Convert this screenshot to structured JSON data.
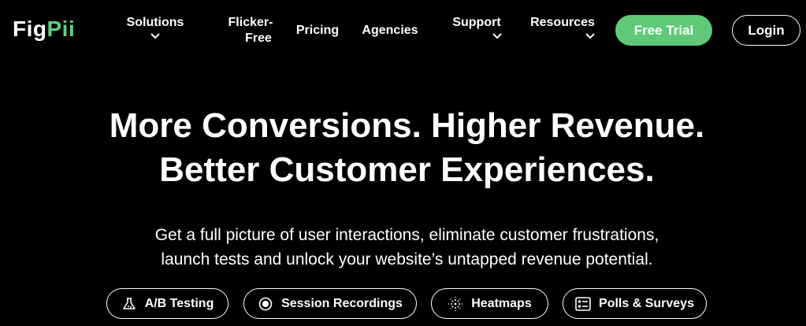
{
  "brand": {
    "logo_fig": "Fig",
    "logo_pii": "Pii",
    "accent": "#5fd07a"
  },
  "nav": {
    "solutions": "Solutions",
    "flicker_line1": "Flicker-",
    "flicker_line2": "Free",
    "pricing": "Pricing",
    "agencies": "Agencies",
    "support": "Support",
    "resources": "Resources",
    "free_trial": "Free Trial",
    "login": "Login"
  },
  "hero": {
    "headline_line1": "More Conversions. Higher Revenue.",
    "headline_line2": "Better Customer Experiences.",
    "sub_line1": "Get a full picture of user interactions, eliminate customer frustrations,",
    "sub_line2": "launch tests and unlock your website’s untapped revenue potential."
  },
  "features": [
    {
      "label": "A/B Testing",
      "icon": "flask-icon"
    },
    {
      "label": "Session Recordings",
      "icon": "record-icon"
    },
    {
      "label": "Heatmaps",
      "icon": "heatmap-icon"
    },
    {
      "label": "Polls & Surveys",
      "icon": "survey-icon"
    }
  ]
}
